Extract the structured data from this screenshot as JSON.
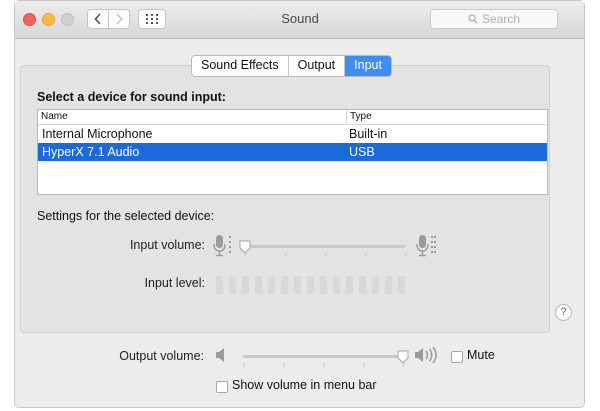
{
  "window": {
    "title": "Sound"
  },
  "search": {
    "placeholder": "Search"
  },
  "tabs": [
    {
      "label": "Sound Effects",
      "active": false
    },
    {
      "label": "Output",
      "active": false
    },
    {
      "label": "Input",
      "active": true
    }
  ],
  "input": {
    "heading": "Select a device for sound input:",
    "columns": {
      "name": "Name",
      "type": "Type"
    },
    "devices": [
      {
        "name": "Internal Microphone",
        "type": "Built-in",
        "selected": false
      },
      {
        "name": "HyperX 7.1 Audio",
        "type": "USB",
        "selected": true
      }
    ],
    "settings_heading": "Settings for the selected device:",
    "input_volume_label": "Input volume:",
    "input_volume_fraction": 0.0,
    "input_level_label": "Input level:",
    "input_level_active_bars": 0,
    "input_level_total_bars": 15
  },
  "output": {
    "volume_label": "Output volume:",
    "volume_fraction": 1.0,
    "mute_label": "Mute",
    "mute_checked": false,
    "show_in_menu_bar_label": "Show volume in menu bar",
    "show_in_menu_bar_checked": false
  },
  "help": {
    "label": "?"
  },
  "colors": {
    "accent": "#3d8ef0",
    "selection": "#1b6ad9"
  }
}
